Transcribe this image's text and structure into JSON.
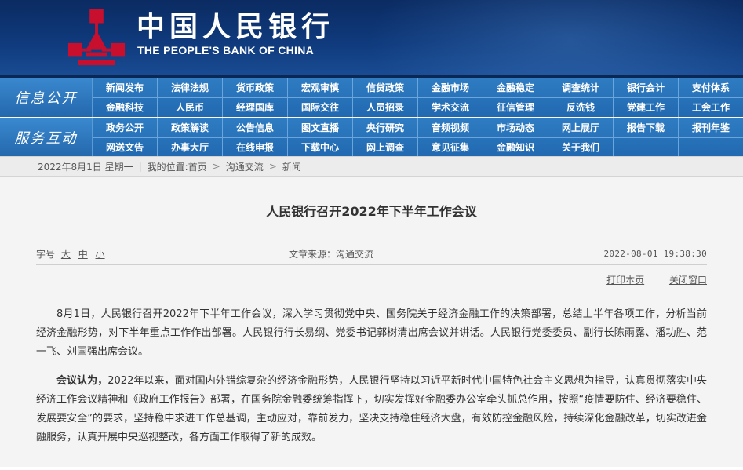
{
  "header": {
    "name_cn": "中国人民银行",
    "name_en": "THE PEOPLE'S BANK OF CHINA",
    "logo_color": "#c8102e"
  },
  "nav": {
    "sections": [
      {
        "title": "信息公开",
        "rows": [
          [
            "新闻发布",
            "法律法规",
            "货币政策",
            "宏观审慎",
            "信贷政策",
            "金融市场",
            "金融稳定",
            "调查统计",
            "银行会计",
            "支付体系"
          ],
          [
            "金融科技",
            "人民币",
            "经理国库",
            "国际交往",
            "人员招录",
            "学术交流",
            "征信管理",
            "反洗钱",
            "党建工作",
            "工会工作"
          ]
        ]
      },
      {
        "title": "服务互动",
        "rows": [
          [
            "政务公开",
            "政策解读",
            "公告信息",
            "图文直播",
            "央行研究",
            "音频视频",
            "市场动态",
            "网上展厅",
            "报告下载",
            "报刊年鉴"
          ],
          [
            "网送文告",
            "办事大厅",
            "在线申报",
            "下载中心",
            "网上调查",
            "意见征集",
            "金融知识",
            "关于我们",
            "",
            ""
          ]
        ]
      }
    ]
  },
  "breadcrumb": {
    "date": "2022年8月1日 星期一",
    "location_label": "我的位置:",
    "items": [
      "首页",
      "沟通交流",
      "新闻"
    ]
  },
  "article": {
    "title": "人民银行召开2022年下半年工作会议",
    "font_size_label": "字号",
    "font_sizes": [
      "大",
      "中",
      "小"
    ],
    "source": "文章来源：沟通交流",
    "datetime": "2022-08-01  19:38:30",
    "print_label": "打印本页",
    "close_label": "关闭窗口",
    "paragraphs": [
      {
        "lead": "",
        "text": "8月1日，人民银行召开2022年下半年工作会议，深入学习贯彻党中央、国务院关于经济金融工作的决策部署，总结上半年各项工作，分析当前经济金融形势，对下半年重点工作作出部署。人民银行行长易纲、党委书记郭树清出席会议并讲话。人民银行党委委员、副行长陈雨露、潘功胜、范一飞、刘国强出席会议。"
      },
      {
        "lead": "会议认为，",
        "text": "2022年以来，面对国内外错综复杂的经济金融形势，人民银行坚持以习近平新时代中国特色社会主义思想为指导，认真贯彻落实中央经济工作会议精神和《政府工作报告》部署，在国务院金融委统筹指挥下，切实发挥好金融委办公室牵头抓总作用，按照“疫情要防住、经济要稳住、发展要安全”的要求，坚持稳中求进工作总基调，主动应对，靠前发力，坚决支持稳住经济大盘，有效防控金融风险，持续深化金融改革，切实改进金融服务，认真开展中央巡视整改，各方面工作取得了新的成效。"
      }
    ]
  }
}
